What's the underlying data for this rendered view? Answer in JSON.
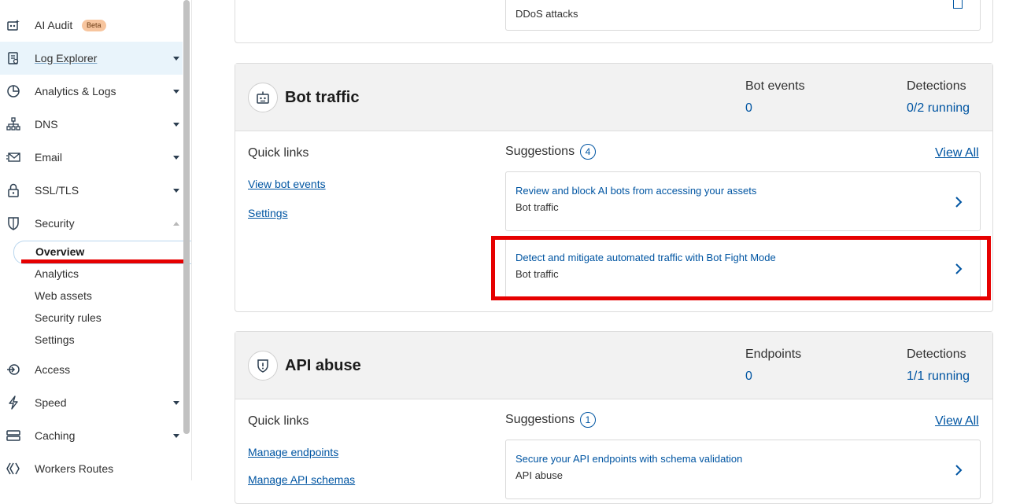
{
  "sidebar": {
    "items": [
      {
        "label": "AI Audit",
        "icon": "ai-audit-icon",
        "badge": "Beta"
      },
      {
        "label": "Log Explorer",
        "icon": "log-explorer-icon"
      },
      {
        "label": "Analytics & Logs",
        "icon": "analytics-icon"
      },
      {
        "label": "DNS",
        "icon": "dns-icon"
      },
      {
        "label": "Email",
        "icon": "email-icon"
      },
      {
        "label": "SSL/TLS",
        "icon": "lock-icon"
      },
      {
        "label": "Security",
        "icon": "shield-icon"
      },
      {
        "label": "Access",
        "icon": "access-icon"
      },
      {
        "label": "Speed",
        "icon": "lightning-icon"
      },
      {
        "label": "Caching",
        "icon": "caching-icon"
      },
      {
        "label": "Workers Routes",
        "icon": "workers-icon"
      }
    ],
    "security_sub": [
      "Overview",
      "Analytics",
      "Web assets",
      "Security rules",
      "Settings"
    ]
  },
  "ddos_card": {
    "text": "DDoS attacks"
  },
  "bot_card": {
    "title": "Bot traffic",
    "stat1_label": "Bot events",
    "stat1_value": "0",
    "stat2_label": "Detections",
    "stat2_value": "0/2 running",
    "quick_links_title": "Quick links",
    "links": [
      "View bot events",
      "Settings"
    ],
    "suggestions_title": "Suggestions",
    "suggestions_count": "4",
    "view_all": "View All",
    "suggestions": [
      {
        "title": "Review and block AI bots from accessing your assets",
        "sub": "Bot traffic"
      },
      {
        "title": "Detect and mitigate automated traffic with Bot Fight Mode",
        "sub": "Bot traffic"
      }
    ]
  },
  "api_card": {
    "title": "API abuse",
    "stat1_label": "Endpoints",
    "stat1_value": "0",
    "stat2_label": "Detections",
    "stat2_value": "1/1 running",
    "quick_links_title": "Quick links",
    "links": [
      "Manage endpoints",
      "Manage API schemas"
    ],
    "suggestions_title": "Suggestions",
    "suggestions_count": "1",
    "view_all": "View All",
    "suggestions": [
      {
        "title": "Secure your API endpoints with schema validation",
        "sub": "API abuse"
      }
    ]
  },
  "colors": {
    "link": "#0055a2",
    "highlight": "#e60000",
    "nav_active_bg": "#e9f4fb"
  }
}
